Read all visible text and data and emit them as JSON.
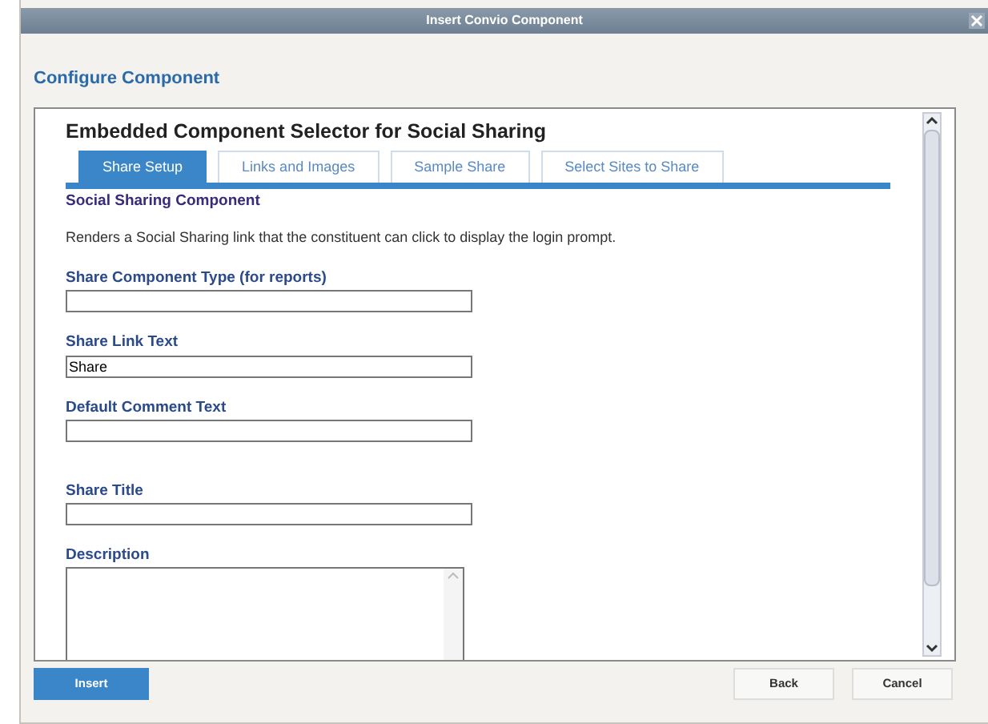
{
  "window": {
    "title": "Insert Convio Component"
  },
  "page_title": "Configure Component",
  "panel": {
    "heading": "Embedded Component Selector for Social Sharing",
    "tabs": [
      {
        "label": "Share Setup",
        "selected": true
      },
      {
        "label": "Links and Images",
        "selected": false
      },
      {
        "label": "Sample Share",
        "selected": false
      },
      {
        "label": "Select Sites to Share",
        "selected": false
      }
    ],
    "section_title": "Social Sharing Component",
    "description": "Renders a Social Sharing link that the constituent can click to display the login prompt.",
    "fields": [
      {
        "kind": "text",
        "label": "Share Component Type (for reports)"
      },
      {
        "kind": "text",
        "label": "Share Link Text",
        "value": "Share"
      },
      {
        "kind": "text",
        "label": "Default Comment Text"
      },
      {
        "kind": "text",
        "label": "Share Title"
      },
      {
        "kind": "textarea",
        "label": "Description"
      }
    ]
  },
  "buttons": [
    {
      "label": "Insert",
      "primary": true
    },
    {
      "label": "Back",
      "primary": false
    },
    {
      "label": "Cancel",
      "primary": false
    }
  ]
}
